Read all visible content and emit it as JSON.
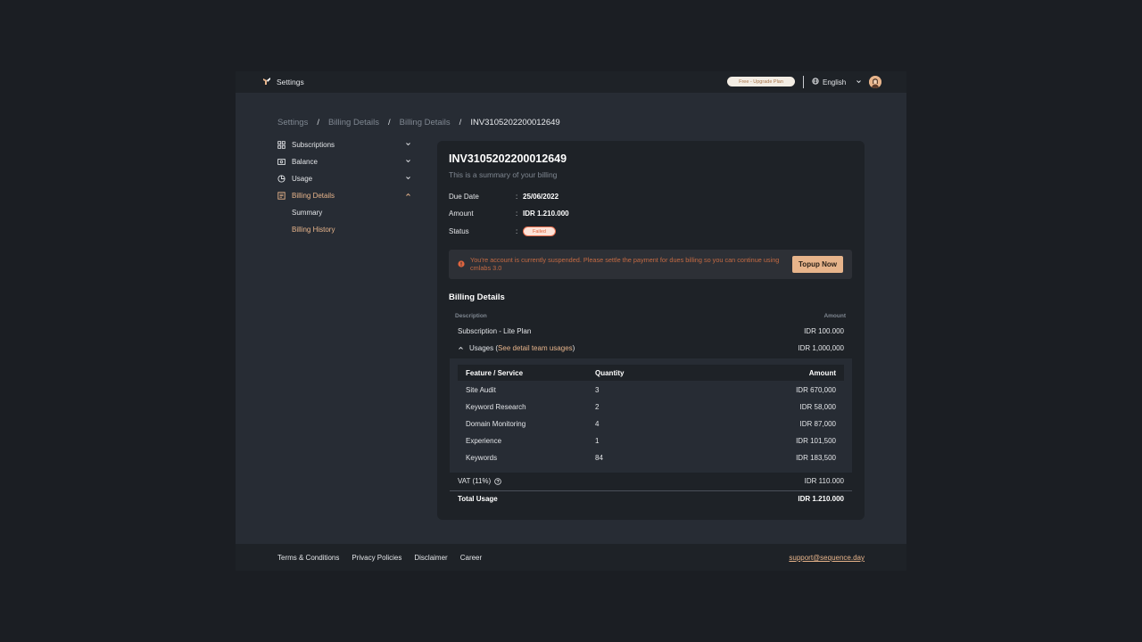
{
  "topbar": {
    "title": "Settings",
    "plan_badge": "Free - Upgrade Plan",
    "language": "English"
  },
  "breadcrumb": [
    "Settings",
    "Billing Details",
    "Billing Details",
    "INV3105202200012649"
  ],
  "sidebar": {
    "items": [
      {
        "label": "Subscriptions",
        "icon": "grid-icon"
      },
      {
        "label": "Balance",
        "icon": "wallet-icon"
      },
      {
        "label": "Usage",
        "icon": "pie-chart-icon"
      },
      {
        "label": "Billing Details",
        "icon": "receipt-icon"
      }
    ],
    "sub_items": [
      "Summary",
      "Billing History"
    ]
  },
  "invoice": {
    "id": "INV3105202200012649",
    "subtitle": "This is a summary of your billing",
    "due_date_label": "Due Date",
    "due_date": "25/06/2022",
    "amount_label": "Amount",
    "amount": "IDR 1.210.000",
    "status_label": "Status",
    "status": "Failed"
  },
  "alert": {
    "message": "You're account is currently suspended. Please settle the payment for dues billing so you can continue using cmlabs 3.0",
    "button": "Topup Now"
  },
  "billing": {
    "title": "Billing Details",
    "col_description": "Description",
    "col_amount": "Amount",
    "subscription_label": "Subscription - Lite Plan",
    "subscription_amount": "IDR 100.000",
    "usages_label": "Usages",
    "usages_paren_open": "(",
    "usages_link": "See detail team usages",
    "usages_paren_close": ")",
    "usages_amount": "IDR 1,000,000",
    "usage_headers": {
      "feature": "Feature / Service",
      "quantity": "Quantity",
      "amount": "Amount"
    },
    "usage_rows": [
      {
        "feature": "Site Audit",
        "quantity": "3",
        "amount": "IDR 670,000"
      },
      {
        "feature": "Keyword Research",
        "quantity": "2",
        "amount": "IDR 58,000"
      },
      {
        "feature": "Domain Monitoring",
        "quantity": "4",
        "amount": "IDR 87,000"
      },
      {
        "feature": "Experience",
        "quantity": "1",
        "amount": "IDR 101,500"
      },
      {
        "feature": "Keywords",
        "quantity": "84",
        "amount": "IDR 183,500"
      }
    ],
    "vat_label": "VAT (11%)",
    "vat_amount": "IDR 110.000",
    "total_label": "Total Usage",
    "total_amount": "IDR 1.210.000"
  },
  "footer": {
    "links": [
      "Terms & Conditions",
      "Privacy Policies",
      "Disclaimer",
      "Career"
    ],
    "email": "support@sequence.day"
  },
  "colors": {
    "accent": "#e7b48b",
    "danger": "#e0653f",
    "background": "#272c34",
    "card": "#1e2227"
  }
}
